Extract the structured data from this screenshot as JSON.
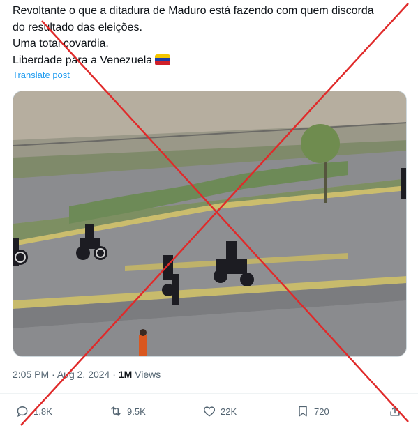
{
  "post": {
    "lines": [
      "Revoltante o que a ditadura de Maduro está fazendo com quem discorda",
      "do resultado das eleições.",
      "Uma total covardia.",
      "Liberdade para a Venezuela"
    ],
    "flag_icon": "venezuela-flag-icon",
    "translate_label": "Translate post"
  },
  "meta": {
    "time": "2:05 PM",
    "separator": "·",
    "date": "Aug 2, 2024",
    "views_count": "1M",
    "views_label": "Views"
  },
  "actions": {
    "replies": "1.8K",
    "reposts": "9.5K",
    "likes": "22K",
    "bookmarks": "720"
  },
  "overlay": {
    "color": "#e02a2a",
    "icon": "red-x-cross-icon"
  },
  "colors": {
    "link": "#1d9bf0",
    "muted": "#536471"
  }
}
